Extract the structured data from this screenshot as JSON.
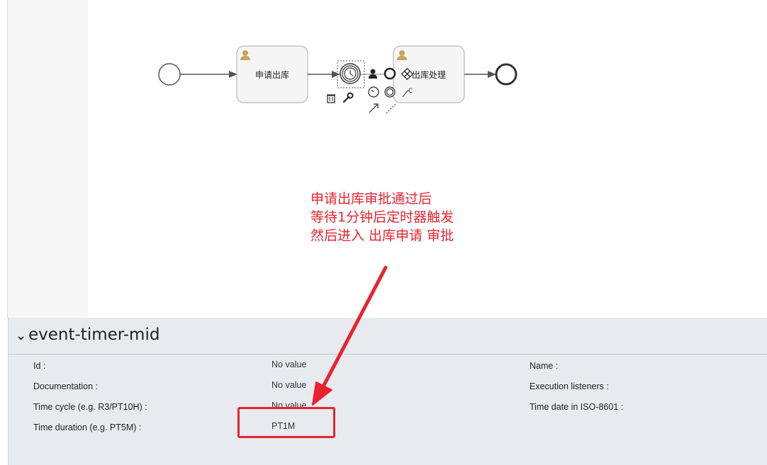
{
  "diagram": {
    "task1_label": "申请出库",
    "task2_label": "出库处理",
    "pad_text_fragment": "C"
  },
  "annotation": {
    "lines": [
      "申请出库审批通过后",
      "等待1分钟后定时器触发",
      "然后进入 出库申请 审批"
    ],
    "color": "#e8232f"
  },
  "properties": {
    "title": "event-timer-mid",
    "left_fields": [
      {
        "label": "Id :",
        "value": "No value"
      },
      {
        "label": "Documentation :",
        "value": "No value"
      },
      {
        "label": "Time cycle (e.g. R3/PT10H) :",
        "value": "No value"
      },
      {
        "label": "Time duration (e.g. PT5M) :",
        "value": "PT1M"
      }
    ],
    "right_fields": [
      {
        "label": "Name :"
      },
      {
        "label": "Execution listeners :"
      },
      {
        "label": "Time date in ISO-8601 :"
      }
    ]
  },
  "icons": [
    "user-icon",
    "trash-icon",
    "wrench-icon",
    "clock-icon",
    "end-event-icon",
    "gateway-icon",
    "intermediate-event-icon",
    "arrow-icon",
    "association-icon"
  ]
}
